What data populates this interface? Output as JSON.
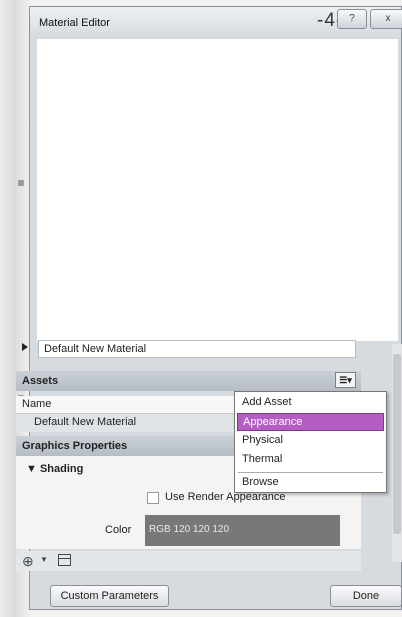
{
  "window": {
    "title": "Material Editor",
    "title_deco": "-4-",
    "help_label": "?",
    "close_label": "x"
  },
  "material": {
    "name": "Default New Material"
  },
  "assets": {
    "header": "Assets",
    "column_name": "Name",
    "rows": [
      "Default New Material"
    ]
  },
  "graphics": {
    "header": "Graphics Properties",
    "shading_label": "Shading",
    "use_render_appearance_label": "Use Render Appearance",
    "use_render_appearance_checked": false,
    "color_label": "Color",
    "color_value": "RGB 120 120 120",
    "color_hex": "#787878"
  },
  "asset_menu": {
    "items": [
      "Add Asset",
      "Appearance",
      "Physical",
      "Thermal",
      "Browse"
    ],
    "selected": "Appearance",
    "highlight_color": "#b45ec4"
  },
  "footer": {
    "custom_parameters_label": "Custom Parameters",
    "done_label": "Done"
  }
}
